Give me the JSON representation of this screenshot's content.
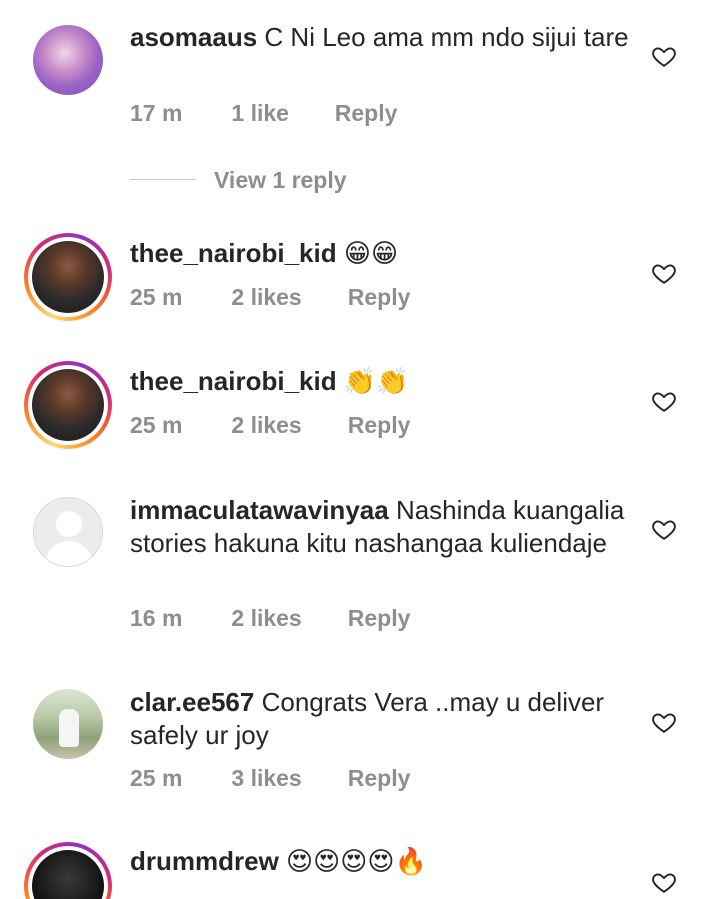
{
  "comments": [
    {
      "username": "asomaaus",
      "text": "C Ni Leo ama mm ndo sijui tare",
      "time": "17 m",
      "likes": "1 like",
      "reply": "Reply",
      "avatar": "purple-photo",
      "story_ring": false
    },
    {
      "username": "thee_nairobi_kid",
      "text": "😁😁",
      "time": "25 m",
      "likes": "2 likes",
      "reply": "Reply",
      "avatar": "dark-photo",
      "story_ring": true
    },
    {
      "username": "thee_nairobi_kid",
      "text": "👏👏",
      "time": "25 m",
      "likes": "2 likes",
      "reply": "Reply",
      "avatar": "dark-photo",
      "story_ring": true
    },
    {
      "username": "immaculatawavinyaa",
      "text": "Nashinda kuangalia stories hakuna kitu nashangaa kuliendaje",
      "time": "16 m",
      "likes": "2 likes",
      "reply": "Reply",
      "avatar": "default-silhouette",
      "story_ring": false
    },
    {
      "username": "clar.ee567",
      "text": "Congrats Vera ..may u deliver safely ur joy",
      "time": "25 m",
      "likes": "3 likes",
      "reply": "Reply",
      "avatar": "outdoor-photo",
      "story_ring": false
    },
    {
      "username": "drummdrew",
      "text": "😍😍😍😍🔥",
      "avatar": "night-photo",
      "story_ring": true
    }
  ],
  "view_replies": {
    "label": "View 1 reply"
  },
  "icons": {
    "like": "heart-outline-icon"
  },
  "colors": {
    "text": "#262626",
    "secondary": "#8e8e8e",
    "ring_start": "#feda75",
    "ring_end": "#d62976"
  }
}
